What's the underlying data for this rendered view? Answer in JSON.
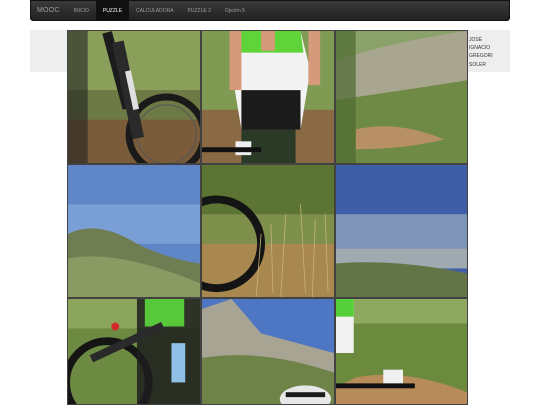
{
  "navbar": {
    "brand": "MOOC",
    "items": [
      {
        "label": "INICIO",
        "active": false
      },
      {
        "label": "PUZZLE",
        "active": true
      },
      {
        "label": "CALCULADORA",
        "active": false
      },
      {
        "label": "PUZZLE 2",
        "active": false
      },
      {
        "label": "Opción 5",
        "active": false
      }
    ]
  },
  "author": {
    "lines": [
      "JOSÉ",
      "IGNACIO",
      "GREGORI",
      "SOLER"
    ]
  },
  "puzzle": {
    "tiles": [
      {
        "name": "puzzle-tile-bike-fork",
        "scene": "bike-fork"
      },
      {
        "name": "puzzle-tile-cyclist-jersey",
        "scene": "jersey"
      },
      {
        "name": "puzzle-tile-hillside",
        "scene": "hillside"
      },
      {
        "name": "puzzle-tile-sky-mountain",
        "scene": "sky-mountain"
      },
      {
        "name": "puzzle-tile-wheel-grass",
        "scene": "wheel-grass"
      },
      {
        "name": "puzzle-tile-valley-view",
        "scene": "valley"
      },
      {
        "name": "puzzle-tile-bike-frame",
        "scene": "bike-frame"
      },
      {
        "name": "puzzle-tile-helmet-rocks",
        "scene": "helmet"
      },
      {
        "name": "puzzle-tile-glove-trail",
        "scene": "glove-trail"
      }
    ]
  }
}
